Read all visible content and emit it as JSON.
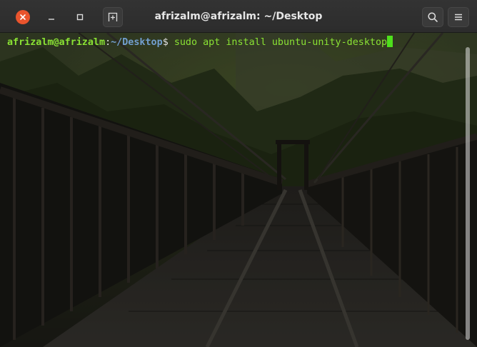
{
  "window": {
    "title": "afrizalm@afrizalm: ~/Desktop"
  },
  "titlebar": {
    "buttons": {
      "close": "close-icon",
      "minimize": "minimize-icon",
      "maximize": "maximize-icon",
      "new_tab": "new-tab-icon",
      "search": "search-icon",
      "menu": "hamburger-menu-icon"
    }
  },
  "terminal": {
    "prompt_user": "afrizalm@afrizalm",
    "prompt_colon": ":",
    "prompt_path": "~/Desktop",
    "prompt_symbol": "$ ",
    "command": "sudo apt install ubuntu-unity-desktop"
  },
  "colors": {
    "close_button": "#e9542d",
    "prompt_user": "#8ae234",
    "prompt_path": "#729fcf",
    "cursor": "#4ee01c"
  }
}
